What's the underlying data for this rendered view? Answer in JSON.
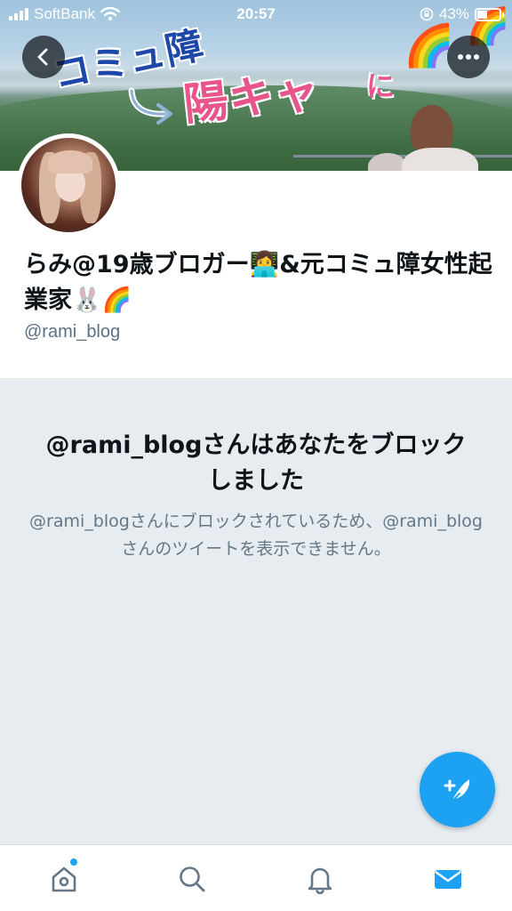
{
  "status_bar": {
    "carrier": "SoftBank",
    "time": "20:57",
    "battery": "43%",
    "battery_level": 0.43,
    "icons": [
      "signal-icon",
      "wifi-icon",
      "orientation-lock-icon",
      "battery-icon"
    ]
  },
  "banner": {
    "line1": "コミュ障",
    "line2": "陽キャ",
    "line3": "に",
    "emoji": "🌈"
  },
  "nav": {
    "back_icon": "back-arrow-icon",
    "more_icon": "more-icon"
  },
  "profile": {
    "display_name": "らみ@19歳ブロガー👩‍💻&元コミュ障女性起業家🐰🌈",
    "handle": "@rami_blog"
  },
  "blocked": {
    "title": "@rami_blogさんはあなたをブロックしました",
    "description": "@rami_blogさんにブロックされているため、@rami_blogさんのツイートを表示できません。"
  },
  "fab": {
    "icon": "compose-tweet-icon"
  },
  "tab_bar": {
    "items": [
      {
        "name": "home",
        "icon": "home-icon",
        "has_badge": true
      },
      {
        "name": "search",
        "icon": "search-icon",
        "has_badge": false
      },
      {
        "name": "notifications",
        "icon": "bell-icon",
        "has_badge": false
      },
      {
        "name": "messages",
        "icon": "envelope-icon",
        "has_badge": false,
        "active": true
      }
    ]
  },
  "colors": {
    "accent": "#1da1f2",
    "panel_bg": "#e6ecf0",
    "secondary_text": "#657786"
  }
}
